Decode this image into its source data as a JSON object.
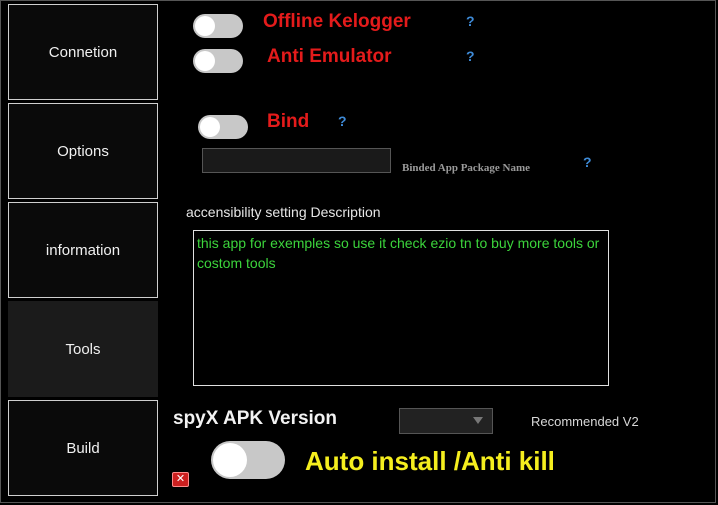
{
  "nav": {
    "items": [
      {
        "label": "Connetion"
      },
      {
        "label": "Options"
      },
      {
        "label": "information"
      },
      {
        "label": "Tools"
      },
      {
        "label": "Build"
      }
    ],
    "active": "Tools"
  },
  "tools": {
    "offline_keylogger": {
      "label": "Offline Kelogger",
      "help": "?",
      "enabled": false
    },
    "anti_emulator": {
      "label": "Anti Emulator",
      "help": "?",
      "enabled": false
    },
    "bind": {
      "label": "Bind",
      "help": "?",
      "enabled": false
    },
    "bind_package": {
      "value": "",
      "label": "Binded App Package Name",
      "help": "?"
    },
    "description": {
      "label": "accensibility setting  Description",
      "text": "this app for exemples so use it check ezio tn to buy more tools or costom tools"
    },
    "apk_version": {
      "label": "spyX APK Version",
      "selected": "",
      "recommended": "Recommended V2"
    },
    "auto_install": {
      "label": "Auto install /Anti kill",
      "enabled": false
    }
  },
  "colors": {
    "background": "#000000",
    "label_red": "#e41b1b",
    "help_blue": "#3e8ad6",
    "desc_green": "#3cd43c",
    "auto_yellow": "#f5ee1e"
  },
  "icons": {
    "help": "question-mark-icon",
    "close": "close-x-icon",
    "dropdown": "chevron-down-icon"
  }
}
